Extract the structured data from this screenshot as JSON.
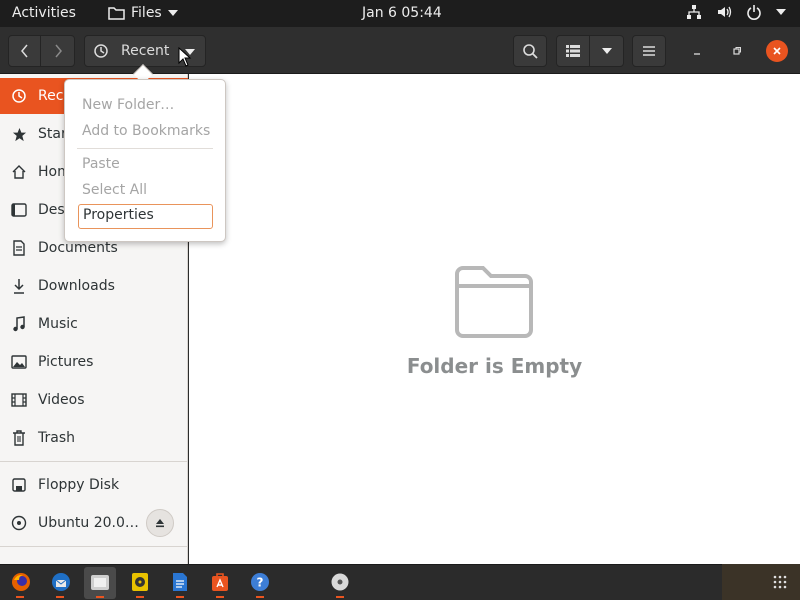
{
  "topbar": {
    "activities": "Activities",
    "app_name": "Files",
    "clock": "Jan 6  05:44"
  },
  "header": {
    "location": "Recent"
  },
  "sidebar": {
    "items": [
      {
        "label": "Recent",
        "icon": "clock-icon"
      },
      {
        "label": "Starred",
        "icon": "star-icon"
      },
      {
        "label": "Home",
        "icon": "home-icon"
      },
      {
        "label": "Desktop",
        "icon": "desktop-icon"
      },
      {
        "label": "Documents",
        "icon": "documents-icon"
      },
      {
        "label": "Downloads",
        "icon": "download-icon"
      },
      {
        "label": "Music",
        "icon": "music-icon"
      },
      {
        "label": "Pictures",
        "icon": "pictures-icon"
      },
      {
        "label": "Videos",
        "icon": "videos-icon"
      },
      {
        "label": "Trash",
        "icon": "trash-icon"
      }
    ],
    "devices": [
      {
        "label": "Floppy Disk",
        "icon": "floppy-icon"
      },
      {
        "label": "Ubuntu 20.0…",
        "icon": "disc-icon"
      }
    ]
  },
  "main": {
    "empty_text": "Folder is Empty"
  },
  "popover": {
    "new_folder": "New Folder…",
    "add_bookmarks": "Add to Bookmarks",
    "paste": "Paste",
    "select_all": "Select All",
    "properties": "Properties"
  },
  "colors": {
    "accent": "#e95420",
    "topbar_bg": "#1d1d1d",
    "headerbar_bg": "#2f2f2f",
    "sidebar_bg": "#f6f5f4"
  }
}
